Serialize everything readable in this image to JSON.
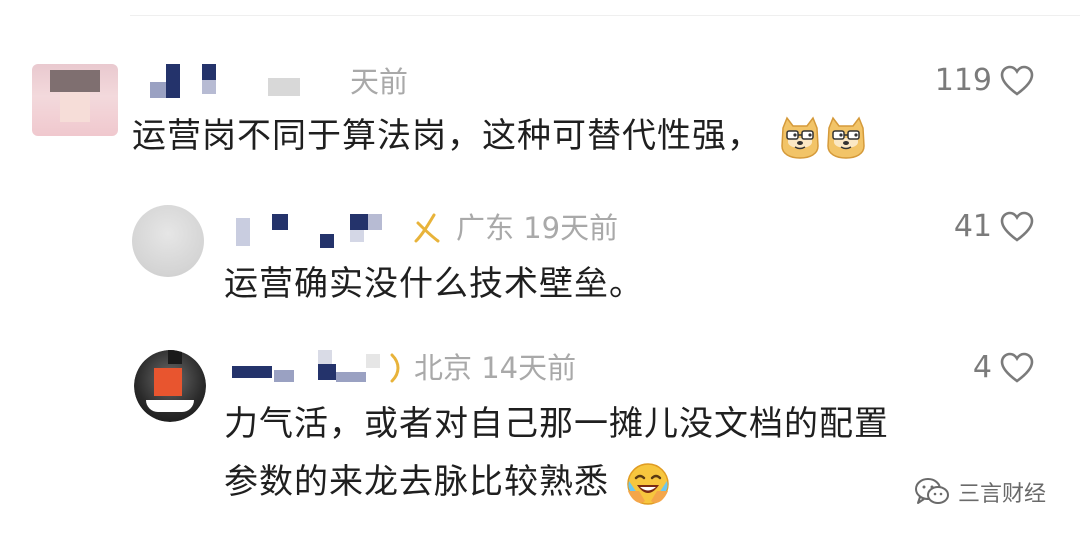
{
  "comments": [
    {
      "meta": "天前",
      "likes": "119",
      "text": "运营岗不同于算法岗，这种可替代性强，",
      "emojis": [
        "doge-glasses-icon",
        "doge-glasses-icon"
      ]
    },
    {
      "meta": "广东 19天前",
      "likes": "41",
      "text": "运营确实没什么技术壁垒。"
    },
    {
      "meta": "北京 14天前",
      "likes": "4",
      "text_line1": "力气活，或者对自己那一摊儿没文档的配置",
      "text_line2": "参数的来龙去脉比较熟悉",
      "emojis": [
        "laughing-crying-icon"
      ]
    }
  ],
  "watermark": "三言财经",
  "colors": {
    "text": "#1f1f1f",
    "meta": "#a9a9a9",
    "likes": "#7b7b7b",
    "pixel_blue": "#24336b"
  }
}
